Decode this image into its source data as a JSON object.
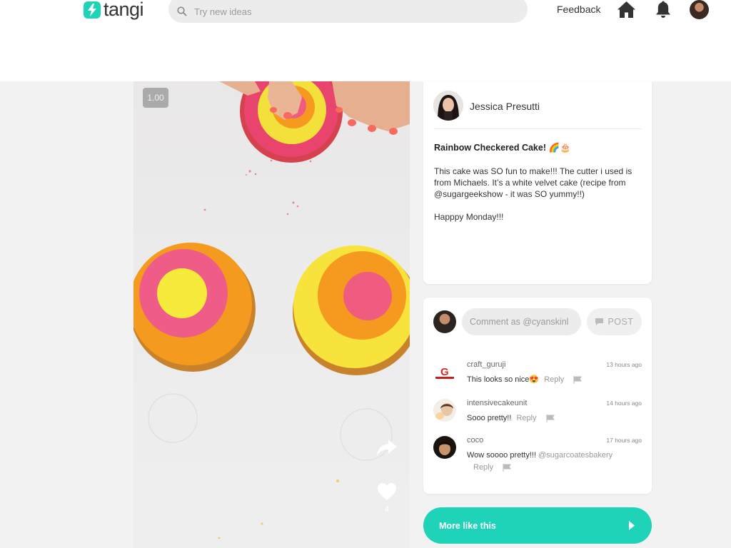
{
  "header": {
    "logo_text": "tangi",
    "search_placeholder": "Try new ideas",
    "feedback_label": "Feedback",
    "icons": [
      "lightning-logo-icon",
      "search-icon",
      "home-icon",
      "bell-icon",
      "user-avatar"
    ]
  },
  "video": {
    "speed_label": "1.00",
    "like_count": "4",
    "icons": [
      "share-icon",
      "heart-icon"
    ]
  },
  "post": {
    "author": "Jessica Presutti",
    "title": "Rainbow Checkered Cake! 🌈🎂",
    "body": "This cake was SO fun to make!!! The cutter i used is from Michaels. It’s a white velvet cake (recipe from @sugargeekshow - it was SO yummy!!)\n\nHapppy Monday!!!"
  },
  "comment_box": {
    "placeholder": "Comment as @cyanskinl",
    "post_label": "POST"
  },
  "comments": [
    {
      "user": "craft_guruji",
      "time": "13 hours ago",
      "text": "This looks so nice😍",
      "mention": "",
      "reply_label": "Reply"
    },
    {
      "user": "intensivecakeunit",
      "time": "14 hours ago",
      "text": "Sooo pretty!!",
      "mention": "",
      "reply_label": "Reply"
    },
    {
      "user": "coco",
      "time": "17 hours ago",
      "text": "Wow soooo pretty!!!",
      "mention": "@sugarcoatesbakery",
      "reply_label": "Reply"
    }
  ],
  "more_button": {
    "label": "More like this"
  },
  "colors": {
    "accent": "#1ed3b7",
    "background": "#f2f2f2",
    "card": "#ffffff"
  }
}
